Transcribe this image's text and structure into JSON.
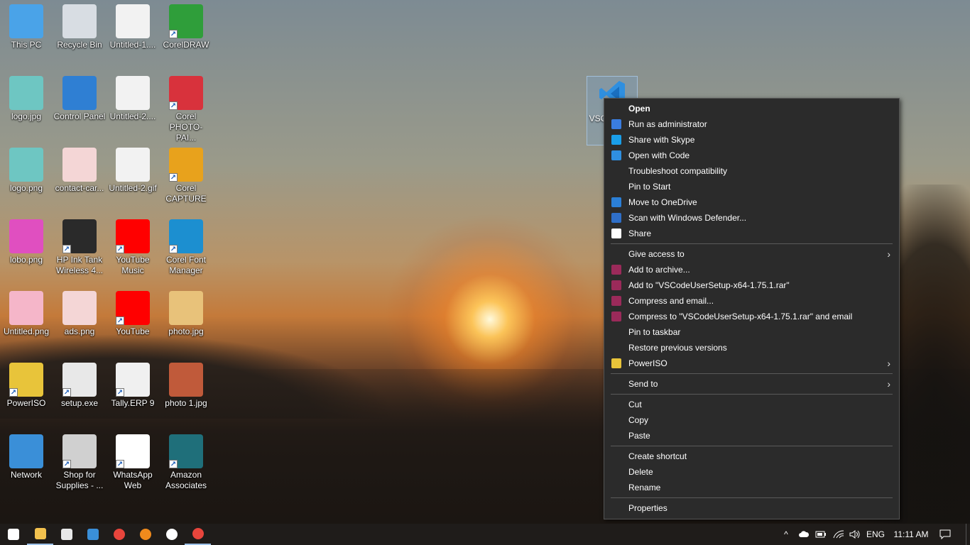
{
  "desktop": {
    "icons": [
      {
        "label": "This PC",
        "icon": "computer-icon",
        "color": "#4aa3e8"
      },
      {
        "label": "Recycle Bin",
        "icon": "recycle-bin-icon",
        "color": "#d8dde3"
      },
      {
        "label": "Untitled-1....",
        "icon": "image-file-icon",
        "color": "#f2f2f2"
      },
      {
        "label": "CorelDRAW",
        "icon": "coreldraw-icon",
        "color": "#2f9e3a"
      },
      {
        "label": "logo.jpg",
        "icon": "image-file-icon",
        "color": "#6ec6c2"
      },
      {
        "label": "Control Panel",
        "icon": "control-panel-icon",
        "color": "#2f7fd3"
      },
      {
        "label": "Untitled-2....",
        "icon": "image-file-icon",
        "color": "#f2f2f2"
      },
      {
        "label": "Corel PHOTO-PAI...",
        "icon": "corel-photo-paint-icon",
        "color": "#d8323c"
      },
      {
        "label": "logo.png",
        "icon": "image-file-icon",
        "color": "#6ec6c2"
      },
      {
        "label": "contact-car...",
        "icon": "image-file-icon",
        "color": "#f4d6d6"
      },
      {
        "label": "Untitled-2.gif",
        "icon": "image-file-icon",
        "color": "#f2f2f2"
      },
      {
        "label": "Corel CAPTURE",
        "icon": "corel-capture-icon",
        "color": "#e8a21c"
      },
      {
        "label": "lobo.png",
        "icon": "image-file-icon",
        "color": "#e04fc0"
      },
      {
        "label": "HP Ink Tank Wireless 4...",
        "icon": "printer-icon",
        "color": "#2a2a2a"
      },
      {
        "label": "YouTube Music",
        "icon": "youtube-music-icon",
        "color": "#ff0000"
      },
      {
        "label": "Corel Font Manager",
        "icon": "corel-font-manager-icon",
        "color": "#1c8fd0"
      },
      {
        "label": "Untitled.png",
        "icon": "image-file-icon",
        "color": "#f5b6c9"
      },
      {
        "label": "ads.png",
        "icon": "image-file-icon",
        "color": "#f4d6d6"
      },
      {
        "label": "YouTube",
        "icon": "youtube-icon",
        "color": "#ff0000"
      },
      {
        "label": "photo.jpg",
        "icon": "image-file-icon",
        "color": "#e8c27a"
      },
      {
        "label": "PowerISO",
        "icon": "poweriso-icon",
        "color": "#e8c43a"
      },
      {
        "label": "setup.exe",
        "icon": "installer-icon",
        "color": "#e8e8e8"
      },
      {
        "label": "Tally.ERP 9",
        "icon": "tally-icon",
        "color": "#f0f0f0"
      },
      {
        "label": "photo 1.jpg",
        "icon": "image-file-icon",
        "color": "#c05a3a"
      },
      {
        "label": "Network",
        "icon": "network-icon",
        "color": "#3a8fd8"
      },
      {
        "label": "Shop for Supplies - ...",
        "icon": "printer-icon",
        "color": "#d0d0d0"
      },
      {
        "label": "WhatsApp Web",
        "icon": "whatsapp-icon",
        "color": "#ffffff"
      },
      {
        "label": "Amazon Associates",
        "icon": "amazon-associates-icon",
        "color": "#1f6f7a"
      }
    ],
    "selected_icon": {
      "label": "VSCod etup 5",
      "icon": "vscode-icon",
      "color": "#2f8fe0"
    }
  },
  "context_menu": {
    "groups": [
      [
        {
          "label": "Open",
          "bold": true,
          "icon": ""
        },
        {
          "label": "Run as administrator",
          "icon": "uac-shield-icon",
          "color": "#3a7de0"
        },
        {
          "label": "Share with Skype",
          "icon": "skype-icon",
          "color": "#1a9ee8"
        },
        {
          "label": "Open with Code",
          "icon": "vscode-icon",
          "color": "#2f8fe0"
        },
        {
          "label": "Troubleshoot compatibility",
          "icon": ""
        },
        {
          "label": "Pin to Start",
          "icon": ""
        },
        {
          "label": "Move to OneDrive",
          "icon": "onedrive-icon",
          "color": "#2b7fd6"
        },
        {
          "label": "Scan with Windows Defender...",
          "icon": "defender-icon",
          "color": "#2f6fc8"
        },
        {
          "label": "Share",
          "icon": "share-icon",
          "color": "#ffffff"
        }
      ],
      [
        {
          "label": "Give access to",
          "icon": "",
          "submenu": true
        },
        {
          "label": "Add to archive...",
          "icon": "winrar-icon",
          "color": "#9b2a5a"
        },
        {
          "label": "Add to \"VSCodeUserSetup-x64-1.75.1.rar\"",
          "icon": "winrar-icon",
          "color": "#9b2a5a"
        },
        {
          "label": "Compress and email...",
          "icon": "winrar-icon",
          "color": "#9b2a5a"
        },
        {
          "label": "Compress to \"VSCodeUserSetup-x64-1.75.1.rar\" and email",
          "icon": "winrar-icon",
          "color": "#9b2a5a"
        },
        {
          "label": "Pin to taskbar",
          "icon": ""
        },
        {
          "label": "Restore previous versions",
          "icon": ""
        },
        {
          "label": "PowerISO",
          "icon": "poweriso-icon",
          "color": "#e8c43a",
          "submenu": true
        }
      ],
      [
        {
          "label": "Send to",
          "icon": "",
          "submenu": true
        }
      ],
      [
        {
          "label": "Cut",
          "icon": ""
        },
        {
          "label": "Copy",
          "icon": ""
        },
        {
          "label": "Paste",
          "icon": ""
        }
      ],
      [
        {
          "label": "Create shortcut",
          "icon": ""
        },
        {
          "label": "Delete",
          "icon": ""
        },
        {
          "label": "Rename",
          "icon": ""
        }
      ],
      [
        {
          "label": "Properties",
          "icon": ""
        }
      ]
    ]
  },
  "taskbar": {
    "items": [
      {
        "name": "start-button",
        "icon": "windows-logo-icon",
        "color": "#ffffff"
      },
      {
        "name": "taskbar-file-explorer",
        "icon": "file-explorer-icon",
        "color": "#f2c14e",
        "active": true
      },
      {
        "name": "taskbar-store",
        "icon": "store-icon",
        "color": "#e8e8e8"
      },
      {
        "name": "taskbar-mail",
        "icon": "mail-icon",
        "color": "#3a8fd8"
      },
      {
        "name": "taskbar-chrome",
        "icon": "chrome-icon",
        "color": "#e8453c"
      },
      {
        "name": "taskbar-blender",
        "icon": "blender-icon",
        "color": "#f08a1c"
      },
      {
        "name": "taskbar-whatsapp",
        "icon": "whatsapp-icon",
        "color": "#ffffff"
      },
      {
        "name": "taskbar-chrome-2",
        "icon": "chrome-icon",
        "color": "#e8453c",
        "active": true
      }
    ],
    "tray": {
      "chevron": "^",
      "language": "ENG",
      "time": "11:11 AM"
    }
  }
}
